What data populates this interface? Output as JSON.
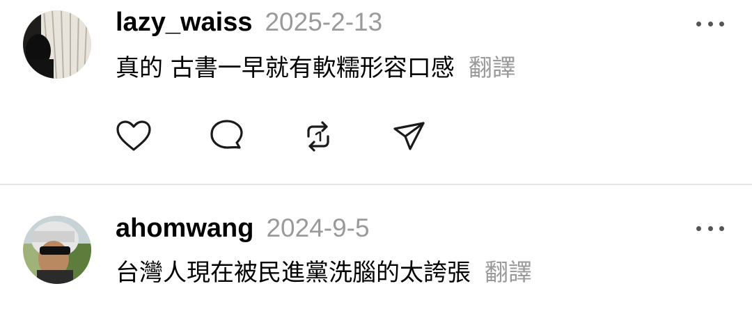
{
  "posts": [
    {
      "username": "lazy_waiss",
      "timestamp": "2025-2-13",
      "text": "真的 古書一早就有軟糯形容口感",
      "translate_label": "翻譯",
      "avatar_icon": "avatar-photo-window",
      "actions": [
        {
          "icon": "heart-icon"
        },
        {
          "icon": "comment-icon"
        },
        {
          "icon": "repost-icon"
        },
        {
          "icon": "share-icon"
        }
      ]
    },
    {
      "username": "ahomwang",
      "timestamp": "2024-9-5",
      "text": "台灣人現在被民進黨洗腦的太誇張",
      "translate_label": "翻譯",
      "avatar_icon": "avatar-photo-helmet"
    }
  ],
  "colors": {
    "text": "#000000",
    "muted": "#9a9a9a",
    "icon": "#1a1a1a",
    "divider": "#e6e6e6"
  }
}
